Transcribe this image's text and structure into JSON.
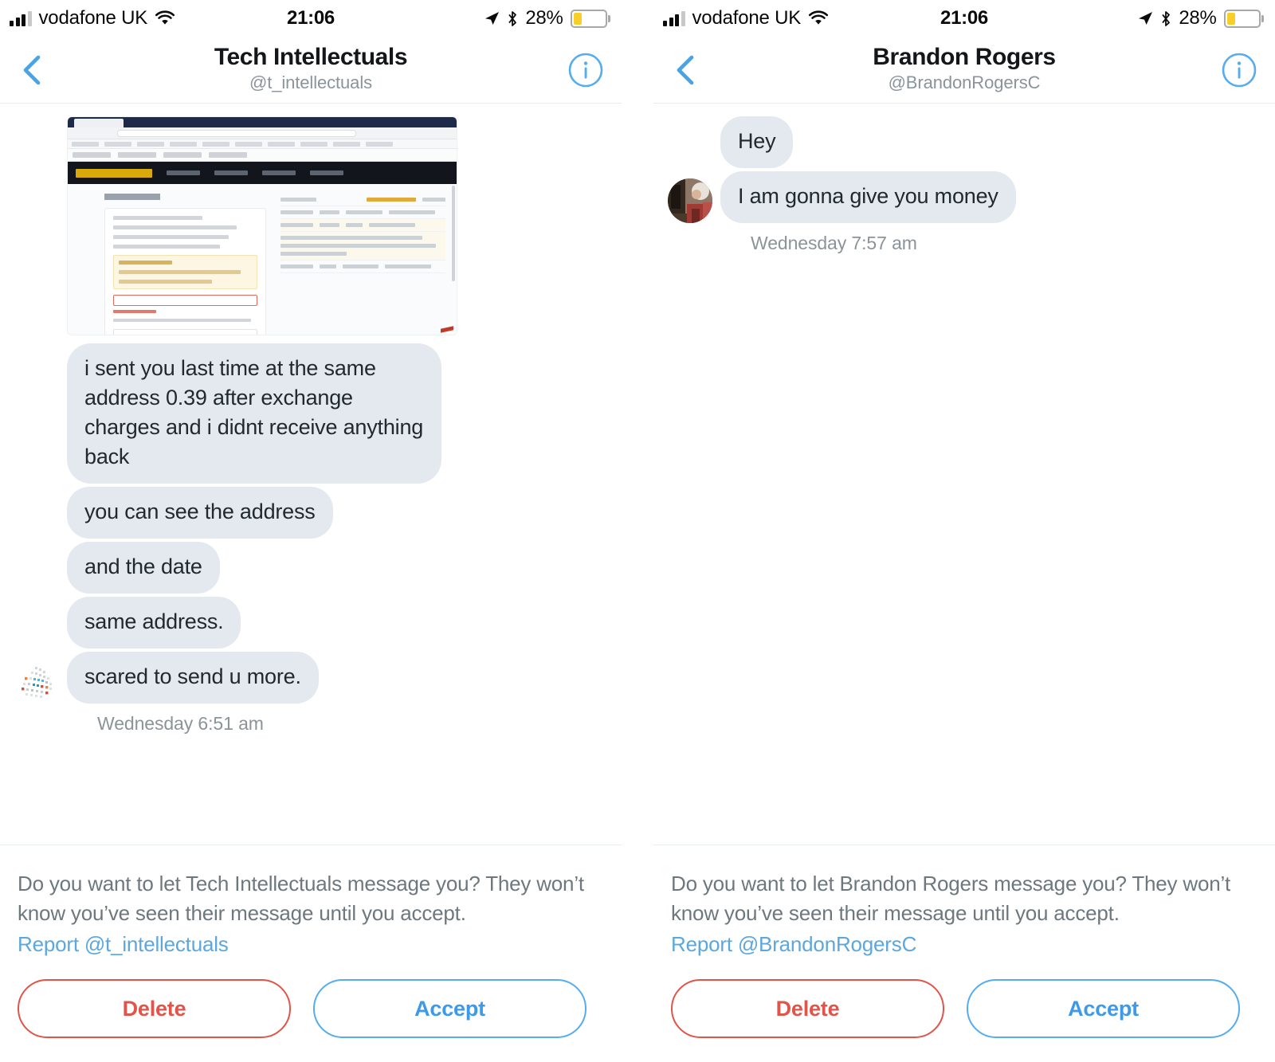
{
  "status_bar": {
    "carrier": "vodafone UK",
    "time": "21:06",
    "battery_percent": "28%",
    "battery_level": 28,
    "icons": [
      "signal-bars-icon",
      "wifi-icon",
      "location-arrow-icon",
      "bluetooth-icon",
      "battery-icon"
    ]
  },
  "colors": {
    "accent_blue": "#55acee",
    "link_blue": "#5ba7de",
    "delete_red": "#e0544a",
    "bubble_gray": "#e3e9ee",
    "muted_text": "#6d787e",
    "battery_yellow": "#f8ce28"
  },
  "panels": [
    {
      "id": "left",
      "nav": {
        "back_icon": "chevron-left-icon",
        "title": "Tech Intellectuals",
        "handle": "@t_intellectuals",
        "info_icon": "info-circle-icon"
      },
      "avatar_type": "logo-mesh",
      "attachment": {
        "name": "binance-withdrawal-screenshot",
        "alt": "Screenshot of a Binance Withdrawals page in a desktop browser"
      },
      "messages": [
        {
          "text": "i sent you last time at the same address 0.39 after exchange charges and i didnt receive anything back",
          "multiline": true
        },
        {
          "text": "you can see the address",
          "multiline": false
        },
        {
          "text": "and the date",
          "multiline": false
        },
        {
          "text": "same address.",
          "multiline": false
        },
        {
          "text": "scared to send u more.",
          "multiline": false,
          "show_avatar": true
        }
      ],
      "timestamp": "Wednesday 6:51 am",
      "request": {
        "prompt": "Do you want to let Tech Intellectuals message you? They won’t know you’ve seen their message until you accept.",
        "report_label": "Report @t_intellectuals",
        "delete_label": "Delete",
        "accept_label": "Accept"
      }
    },
    {
      "id": "right",
      "nav": {
        "back_icon": "chevron-left-icon",
        "title": "Brandon Rogers",
        "handle": "@BrandonRogersC",
        "info_icon": "info-circle-icon"
      },
      "avatar_type": "photo",
      "attachment": null,
      "messages": [
        {
          "text": "Hey",
          "multiline": false
        },
        {
          "text": "I am gonna give you money",
          "multiline": false,
          "show_avatar": true
        }
      ],
      "timestamp": "Wednesday 7:57 am",
      "request": {
        "prompt": "Do you want to let Brandon Rogers message you? They won’t know you’ve seen their message until you accept.",
        "report_label": "Report @BrandonRogersC",
        "delete_label": "Delete",
        "accept_label": "Accept"
      }
    }
  ]
}
